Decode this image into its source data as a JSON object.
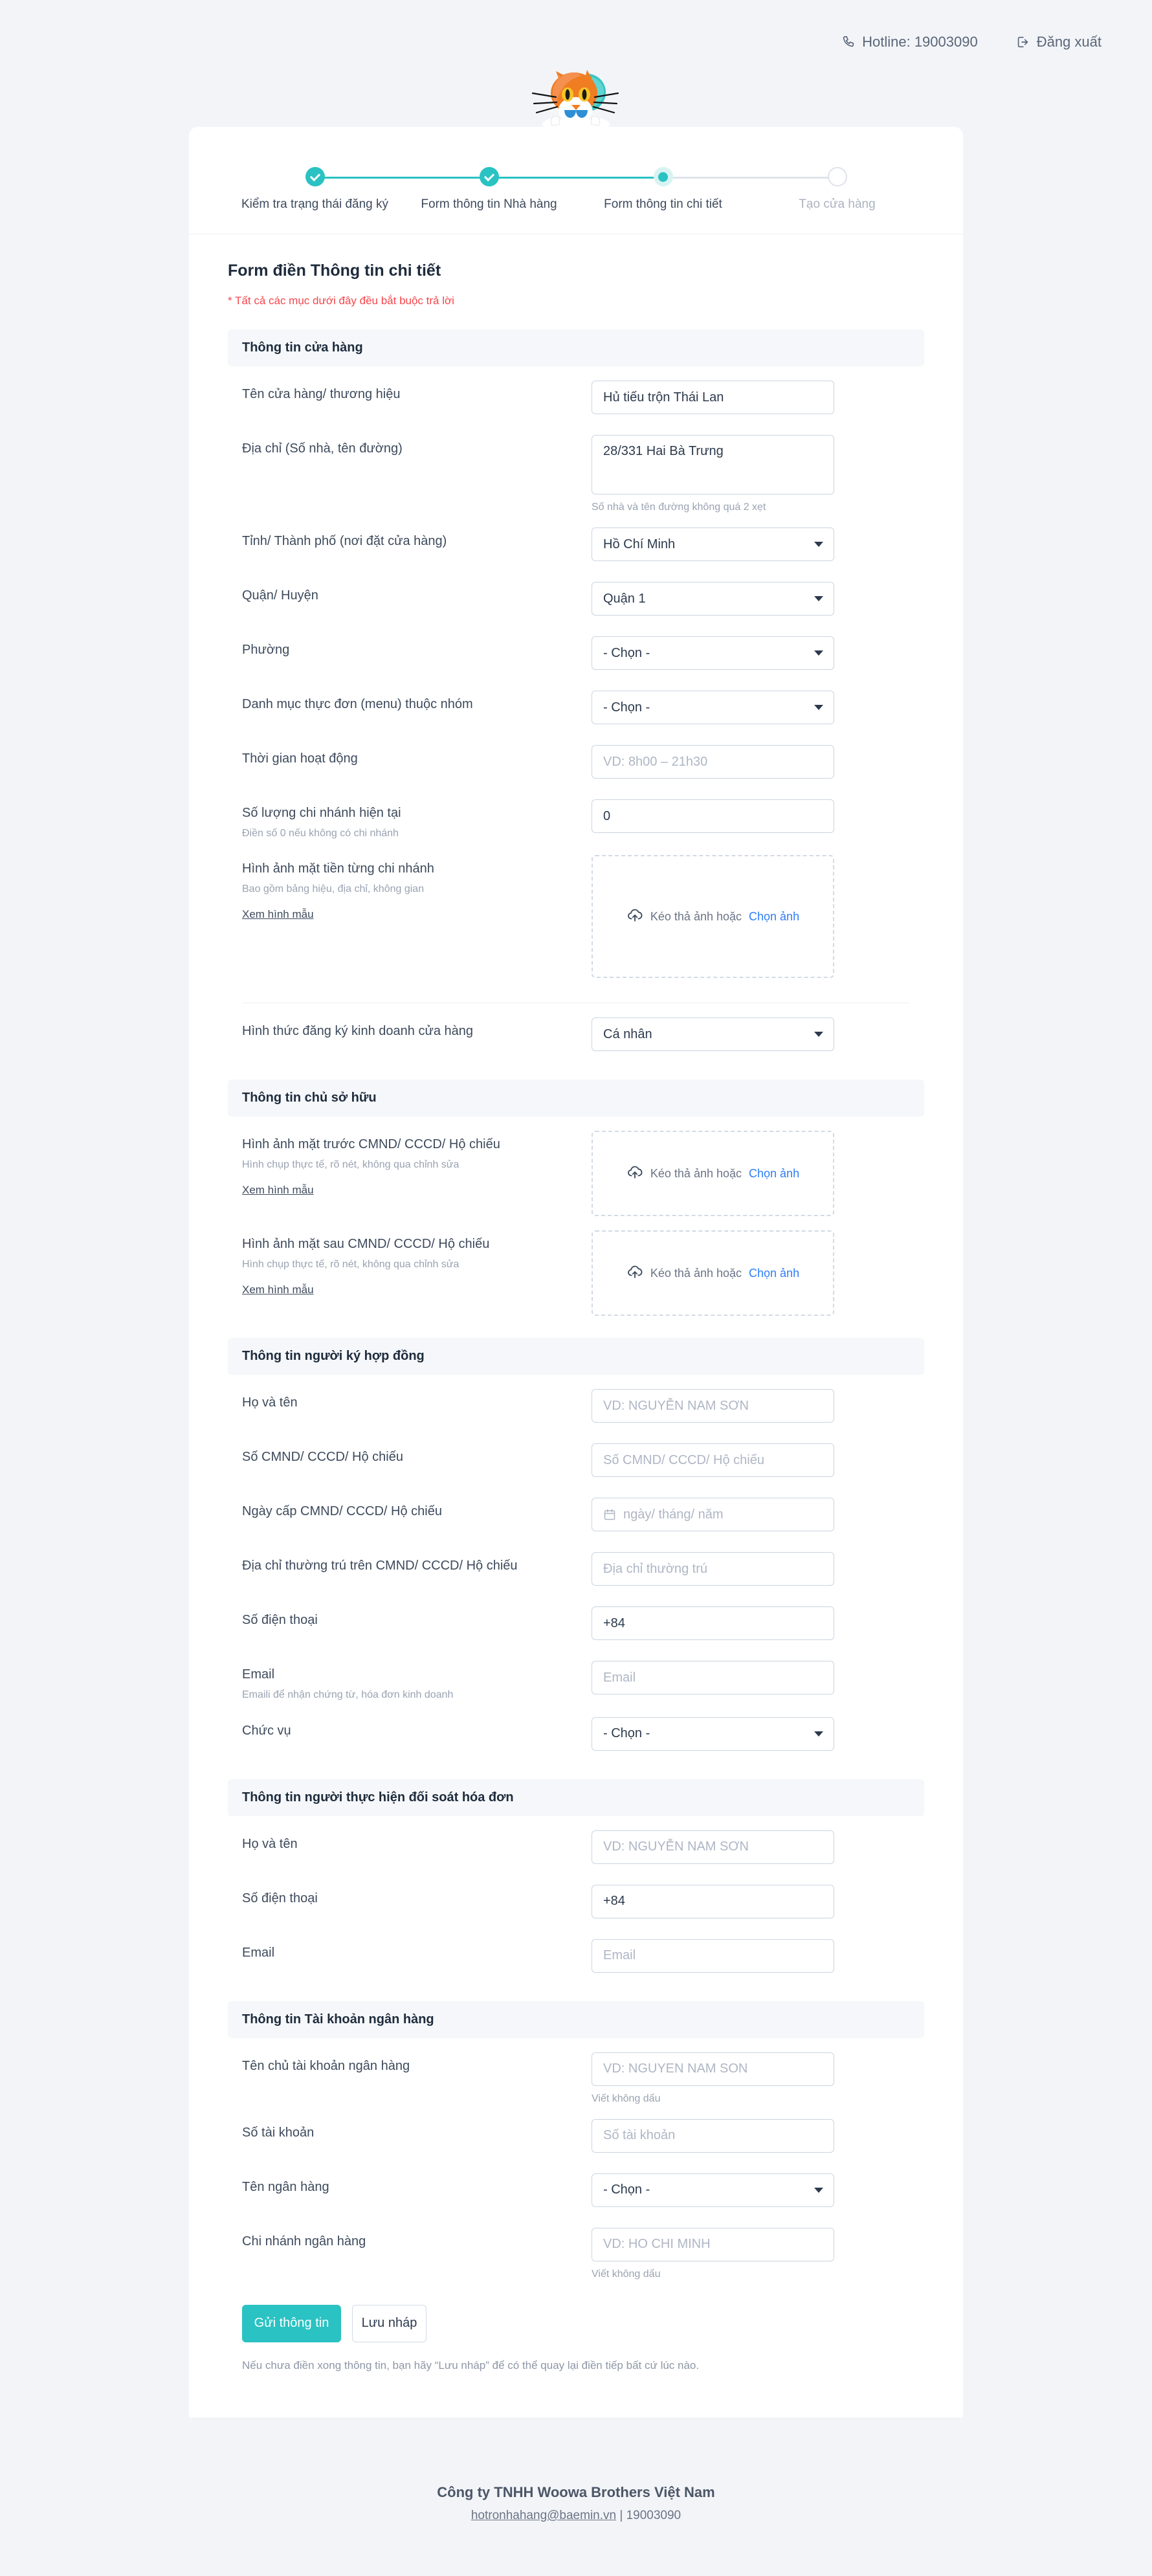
{
  "topbar": {
    "hotline": "Hotline: 19003090",
    "logout": "Đăng xuất"
  },
  "stepper": {
    "steps": [
      {
        "label": "Kiểm tra trạng thái đăng ký",
        "state": "done"
      },
      {
        "label": "Form thông tin Nhà hàng",
        "state": "done"
      },
      {
        "label": "Form thông tin chi tiết",
        "state": "active"
      },
      {
        "label": "Tạo cửa hàng",
        "state": "todo"
      }
    ]
  },
  "form": {
    "title": "Form điền Thông tin chi tiết",
    "required_note": "* Tất cả các mục dưới đây đều bắt buộc trả lời",
    "upload_text": "Kéo thả ảnh hoặc",
    "upload_link": "Chọn ảnh",
    "sample_link": "Xem hình mẫu",
    "select_placeholder": "- Chọn -"
  },
  "sections": {
    "store": {
      "heading": "Thông tin cửa hàng",
      "store_name": {
        "label": "Tên cửa hàng/ thương hiệu",
        "value": "Hủ tiếu trộn Thái Lan"
      },
      "address": {
        "label": "Địa chỉ (Số nhà, tên đường)",
        "value": "28/331 Hai Bà Trưng",
        "hint": "Số nhà và tên đường không quá 2 xẹt"
      },
      "city": {
        "label": "Tỉnh/ Thành phố (nơi đặt cửa hàng)",
        "value": "Hồ Chí Minh"
      },
      "district": {
        "label": "Quận/ Huyện",
        "value": "Quận 1"
      },
      "ward": {
        "label": "Phường",
        "value": "- Chọn -"
      },
      "menu_group": {
        "label": "Danh mục thực đơn (menu) thuộc nhóm",
        "value": "- Chọn -"
      },
      "hours": {
        "label": "Thời gian hoạt động",
        "placeholder": "VD: 8h00 – 21h30"
      },
      "branch_count": {
        "label": "Số lượng chi nhánh hiện tại",
        "sub": "Điền số 0 nếu không có chi nhánh",
        "value": "0"
      },
      "storefront_photo": {
        "label": "Hình ảnh mặt tiền từng chi nhánh",
        "sub": "Bao gồm bảng hiệu, địa chỉ, không gian"
      },
      "business_type": {
        "label": "Hình thức đăng ký kinh doanh cửa hàng",
        "value": "Cá nhân"
      }
    },
    "owner": {
      "heading": "Thông tin chủ sở hữu",
      "id_front": {
        "label": "Hình ảnh mặt trước CMND/ CCCD/ Hộ chiếu",
        "sub": "Hình chụp thực tế, rõ nét, không qua chỉnh sửa"
      },
      "id_back": {
        "label": "Hình ảnh mặt sau CMND/ CCCD/ Hộ chiếu",
        "sub": "Hình chụp thực tế, rõ nét, không qua chỉnh sửa"
      }
    },
    "signer": {
      "heading": "Thông tin người ký hợp đồng",
      "full_name": {
        "label": "Họ và tên",
        "placeholder": "VD: NGUYỄN NAM SƠN"
      },
      "id_number": {
        "label": "Số CMND/ CCCD/ Hộ chiếu",
        "placeholder": "Số CMND/ CCCD/ Hộ chiếu"
      },
      "id_issue_date": {
        "label": "Ngày cấp CMND/ CCCD/ Hộ chiếu",
        "placeholder": "ngày/ tháng/ năm"
      },
      "permanent_address": {
        "label": "Địa chỉ thường trú trên CMND/ CCCD/ Hộ chiếu",
        "placeholder": "Địa chỉ thường trú"
      },
      "phone": {
        "label": "Số điện thoại",
        "value": "+84"
      },
      "email": {
        "label": "Email",
        "sub": "Emaili để nhận chứng từ, hóa đơn kinh doanh",
        "placeholder": "Email"
      },
      "position": {
        "label": "Chức vụ",
        "value": "- Chọn -"
      }
    },
    "reconciliation": {
      "heading": "Thông tin người thực hiện đối soát hóa đơn",
      "full_name": {
        "label": "Họ và tên",
        "placeholder": "VD: NGUYỄN NAM SƠN"
      },
      "phone": {
        "label": "Số điện thoại",
        "value": "+84"
      },
      "email": {
        "label": "Email",
        "placeholder": "Email"
      }
    },
    "bank": {
      "heading": "Thông tin Tài khoản ngân hàng",
      "account_holder": {
        "label": "Tên chủ tài khoản ngân hàng",
        "placeholder": "VD: NGUYEN NAM SON",
        "hint": "Viết không dấu"
      },
      "account_number": {
        "label": "Số tài khoản",
        "placeholder": "Số tài khoản"
      },
      "bank_name": {
        "label": "Tên ngân hàng",
        "value": "- Chọn -"
      },
      "bank_branch": {
        "label": "Chi nhánh ngân hàng",
        "placeholder": "VD: HO CHI MINH",
        "hint": "Viết không dấu"
      }
    }
  },
  "actions": {
    "submit": "Gửi thông tin",
    "save_draft": "Lưu nháp",
    "note": "Nếu chưa điền xong thông tin, bạn hãy “Lưu nháp” để có thể quay lại điền tiếp bất cứ lúc nào."
  },
  "footer": {
    "company": "Công ty TNHH Woowa Brothers Việt Nam",
    "email": "hotronhahang@baemin.vn",
    "separator": " | ",
    "phone": "19003090"
  },
  "colors": {
    "accent": "#2ac2c2",
    "required": "#f4464b",
    "link": "#2f7df6"
  }
}
